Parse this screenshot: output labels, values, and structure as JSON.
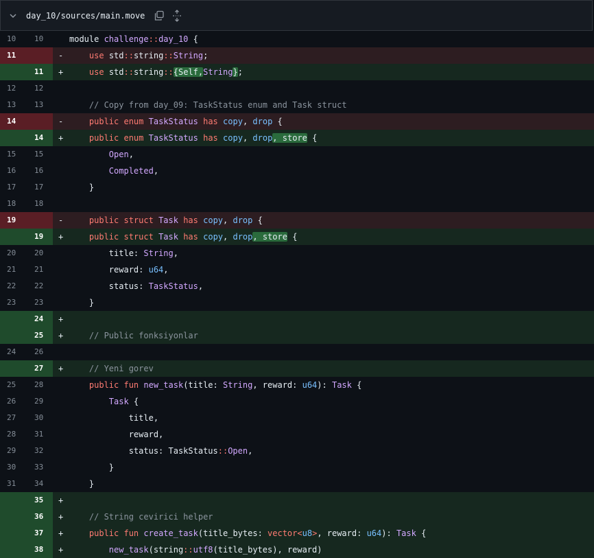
{
  "file": {
    "path": "day_10/sources/main.move",
    "collapse_icon": "chevron-down-icon",
    "copy_icon": "copy-icon",
    "expand_icon": "unfold-icon"
  },
  "colors": {
    "del_bg": "#2d1d21",
    "del_num": "#5a1e25",
    "add_bg": "#16281f",
    "add_num": "#1f4b2c",
    "keyword": "#ff7b72",
    "type": "#d2a8ff",
    "ability": "#79c0ff",
    "comment": "#8b949e"
  },
  "lines": [
    {
      "type": "ctx",
      "old": "10",
      "new": "10",
      "marker": "",
      "tokens": [
        [
          "",
          "module "
        ],
        [
          "t-ty",
          "challenge"
        ],
        [
          "t-kw",
          "::"
        ],
        [
          "t-ty",
          "day_10"
        ],
        [
          "",
          " {"
        ]
      ]
    },
    {
      "type": "del",
      "old": "11",
      "new": "",
      "marker": "-",
      "tokens": [
        [
          "",
          "    "
        ],
        [
          "t-kw",
          "use"
        ],
        [
          "",
          " std"
        ],
        [
          "t-kw",
          "::"
        ],
        [
          "",
          "string"
        ],
        [
          "t-kw",
          "::"
        ],
        [
          "t-ty",
          "String"
        ],
        [
          "",
          ";"
        ]
      ]
    },
    {
      "type": "add",
      "old": "",
      "new": "11",
      "marker": "+",
      "tokens": [
        [
          "",
          "    "
        ],
        [
          "t-kw",
          "use"
        ],
        [
          "",
          " std"
        ],
        [
          "t-kw",
          "::"
        ],
        [
          "",
          "string"
        ],
        [
          "t-kw",
          "::"
        ],
        [
          "t-hi",
          "{Self,"
        ],
        [
          "t-ty",
          "String"
        ],
        [
          "t-hi",
          "}"
        ],
        [
          "",
          ";"
        ]
      ]
    },
    {
      "type": "ctx",
      "old": "12",
      "new": "12",
      "marker": "",
      "tokens": []
    },
    {
      "type": "ctx",
      "old": "13",
      "new": "13",
      "marker": "",
      "tokens": [
        [
          "",
          "    "
        ],
        [
          "t-cm",
          "// Copy from day_09: TaskStatus enum and Task struct"
        ]
      ]
    },
    {
      "type": "del",
      "old": "14",
      "new": "",
      "marker": "-",
      "tokens": [
        [
          "",
          "    "
        ],
        [
          "t-kw",
          "public enum"
        ],
        [
          "",
          " "
        ],
        [
          "t-ty",
          "TaskStatus"
        ],
        [
          "",
          " "
        ],
        [
          "t-kw",
          "has"
        ],
        [
          "",
          " "
        ],
        [
          "t-ab",
          "copy"
        ],
        [
          "",
          ", "
        ],
        [
          "t-ab",
          "drop"
        ],
        [
          "",
          " {"
        ]
      ]
    },
    {
      "type": "add",
      "old": "",
      "new": "14",
      "marker": "+",
      "tokens": [
        [
          "",
          "    "
        ],
        [
          "t-kw",
          "public enum"
        ],
        [
          "",
          " "
        ],
        [
          "t-ty",
          "TaskStatus"
        ],
        [
          "",
          " "
        ],
        [
          "t-kw",
          "has"
        ],
        [
          "",
          " "
        ],
        [
          "t-ab",
          "copy"
        ],
        [
          "",
          ", "
        ],
        [
          "t-ab",
          "drop"
        ],
        [
          "t-hi",
          ", store"
        ],
        [
          "",
          " {"
        ]
      ]
    },
    {
      "type": "ctx",
      "old": "15",
      "new": "15",
      "marker": "",
      "tokens": [
        [
          "",
          "        "
        ],
        [
          "t-ty",
          "Open"
        ],
        [
          "",
          ","
        ]
      ]
    },
    {
      "type": "ctx",
      "old": "16",
      "new": "16",
      "marker": "",
      "tokens": [
        [
          "",
          "        "
        ],
        [
          "t-ty",
          "Completed"
        ],
        [
          "",
          ","
        ]
      ]
    },
    {
      "type": "ctx",
      "old": "17",
      "new": "17",
      "marker": "",
      "tokens": [
        [
          "",
          "    }"
        ]
      ]
    },
    {
      "type": "ctx",
      "old": "18",
      "new": "18",
      "marker": "",
      "tokens": []
    },
    {
      "type": "del",
      "old": "19",
      "new": "",
      "marker": "-",
      "tokens": [
        [
          "",
          "    "
        ],
        [
          "t-kw",
          "public struct"
        ],
        [
          "",
          " "
        ],
        [
          "t-ty",
          "Task"
        ],
        [
          "",
          " "
        ],
        [
          "t-kw",
          "has"
        ],
        [
          "",
          " "
        ],
        [
          "t-ab",
          "copy"
        ],
        [
          "",
          ", "
        ],
        [
          "t-ab",
          "drop"
        ],
        [
          "",
          " {"
        ]
      ]
    },
    {
      "type": "add",
      "old": "",
      "new": "19",
      "marker": "+",
      "tokens": [
        [
          "",
          "    "
        ],
        [
          "t-kw",
          "public struct"
        ],
        [
          "",
          " "
        ],
        [
          "t-ty",
          "Task"
        ],
        [
          "",
          " "
        ],
        [
          "t-kw",
          "has"
        ],
        [
          "",
          " "
        ],
        [
          "t-ab",
          "copy"
        ],
        [
          "",
          ", "
        ],
        [
          "t-ab",
          "drop"
        ],
        [
          "t-hi",
          ", store"
        ],
        [
          "",
          " {"
        ]
      ]
    },
    {
      "type": "ctx",
      "old": "20",
      "new": "20",
      "marker": "",
      "tokens": [
        [
          "",
          "        title: "
        ],
        [
          "t-ty",
          "String"
        ],
        [
          "",
          ","
        ]
      ]
    },
    {
      "type": "ctx",
      "old": "21",
      "new": "21",
      "marker": "",
      "tokens": [
        [
          "",
          "        reward: "
        ],
        [
          "t-ab",
          "u64"
        ],
        [
          "",
          ","
        ]
      ]
    },
    {
      "type": "ctx",
      "old": "22",
      "new": "22",
      "marker": "",
      "tokens": [
        [
          "",
          "        status: "
        ],
        [
          "t-ty",
          "TaskStatus"
        ],
        [
          "",
          ","
        ]
      ]
    },
    {
      "type": "ctx",
      "old": "23",
      "new": "23",
      "marker": "",
      "tokens": [
        [
          "",
          "    }"
        ]
      ]
    },
    {
      "type": "add",
      "old": "",
      "new": "24",
      "marker": "+",
      "tokens": []
    },
    {
      "type": "add",
      "old": "",
      "new": "25",
      "marker": "+",
      "tokens": [
        [
          "",
          "    "
        ],
        [
          "t-cm",
          "// Public fonksiyonlar"
        ]
      ]
    },
    {
      "type": "ctx",
      "old": "24",
      "new": "26",
      "marker": "",
      "tokens": []
    },
    {
      "type": "add",
      "old": "",
      "new": "27",
      "marker": "+",
      "tokens": [
        [
          "",
          "    "
        ],
        [
          "t-cm",
          "// Yeni gorev"
        ]
      ]
    },
    {
      "type": "ctx",
      "old": "25",
      "new": "28",
      "marker": "",
      "tokens": [
        [
          "",
          "    "
        ],
        [
          "t-kw",
          "public fun"
        ],
        [
          "",
          " "
        ],
        [
          "t-fn",
          "new_task"
        ],
        [
          "",
          "(title: "
        ],
        [
          "t-ty",
          "String"
        ],
        [
          "",
          ", reward: "
        ],
        [
          "t-ab",
          "u64"
        ],
        [
          "",
          "): "
        ],
        [
          "t-ty",
          "Task"
        ],
        [
          "",
          " {"
        ]
      ]
    },
    {
      "type": "ctx",
      "old": "26",
      "new": "29",
      "marker": "",
      "tokens": [
        [
          "",
          "        "
        ],
        [
          "t-ty",
          "Task"
        ],
        [
          "",
          " {"
        ]
      ]
    },
    {
      "type": "ctx",
      "old": "27",
      "new": "30",
      "marker": "",
      "tokens": [
        [
          "",
          "            title,"
        ]
      ]
    },
    {
      "type": "ctx",
      "old": "28",
      "new": "31",
      "marker": "",
      "tokens": [
        [
          "",
          "            reward,"
        ]
      ]
    },
    {
      "type": "ctx",
      "old": "29",
      "new": "32",
      "marker": "",
      "tokens": [
        [
          "",
          "            status: TaskStatus"
        ],
        [
          "t-kw",
          "::"
        ],
        [
          "t-ty",
          "Open"
        ],
        [
          "",
          ","
        ]
      ]
    },
    {
      "type": "ctx",
      "old": "30",
      "new": "33",
      "marker": "",
      "tokens": [
        [
          "",
          "        }"
        ]
      ]
    },
    {
      "type": "ctx",
      "old": "31",
      "new": "34",
      "marker": "",
      "tokens": [
        [
          "",
          "    }"
        ]
      ]
    },
    {
      "type": "add",
      "old": "",
      "new": "35",
      "marker": "+",
      "tokens": []
    },
    {
      "type": "add",
      "old": "",
      "new": "36",
      "marker": "+",
      "tokens": [
        [
          "",
          "    "
        ],
        [
          "t-cm",
          "// String cevirici helper"
        ]
      ]
    },
    {
      "type": "add",
      "old": "",
      "new": "37",
      "marker": "+",
      "tokens": [
        [
          "",
          "    "
        ],
        [
          "t-kw",
          "public fun"
        ],
        [
          "",
          " "
        ],
        [
          "t-fn",
          "create_task"
        ],
        [
          "",
          "(title_bytes: "
        ],
        [
          "t-kw",
          "vector"
        ],
        [
          "t-kw",
          "<"
        ],
        [
          "t-ab",
          "u8"
        ],
        [
          "t-kw",
          ">"
        ],
        [
          "",
          ", reward: "
        ],
        [
          "t-ab",
          "u64"
        ],
        [
          "",
          "): "
        ],
        [
          "t-ty",
          "Task"
        ],
        [
          "",
          " {"
        ]
      ]
    },
    {
      "type": "add",
      "old": "",
      "new": "38",
      "marker": "+",
      "tokens": [
        [
          "",
          "        "
        ],
        [
          "t-fn",
          "new_task"
        ],
        [
          "",
          "(string"
        ],
        [
          "t-kw",
          "::"
        ],
        [
          "t-fn",
          "utf8"
        ],
        [
          "",
          "(title_bytes), reward)"
        ]
      ]
    }
  ]
}
